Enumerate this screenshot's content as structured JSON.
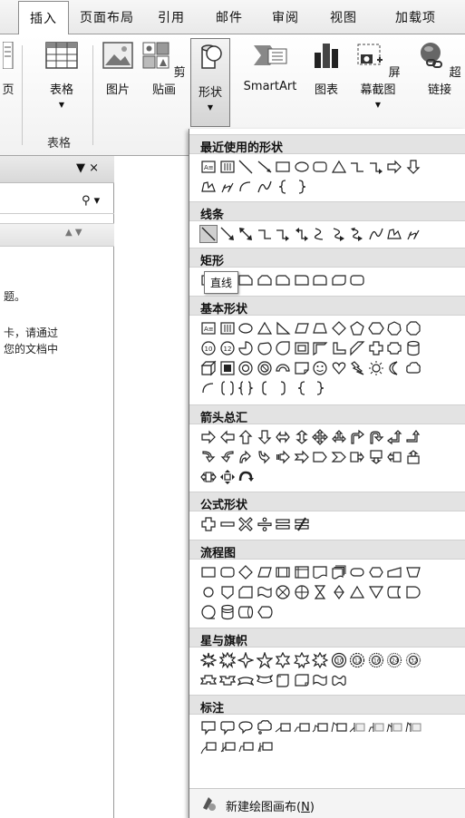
{
  "tabs": [
    {
      "id": "insert",
      "label": "插入",
      "active": true
    },
    {
      "id": "page-layout",
      "label": "页面布局"
    },
    {
      "id": "references",
      "label": "引用"
    },
    {
      "id": "mailings",
      "label": "邮件"
    },
    {
      "id": "review",
      "label": "审阅"
    },
    {
      "id": "view",
      "label": "视图"
    },
    {
      "id": "addins",
      "label": "加载项"
    }
  ],
  "ribbon": {
    "page_label": "页",
    "table_label": "表格",
    "table_group_label": "表格",
    "picture_label": "图片",
    "clipart_label": "剪贴画",
    "shapes_label": "形状",
    "smartart_label": "SmartArt",
    "chart_label": "图表",
    "screenshot_label": "屏幕截图",
    "hyperlink_label": "超链接"
  },
  "doc_pane": {
    "close_glyph": "▼ ×",
    "search_glyph": "⚲ ▾",
    "nav_glyph": "▲ ▼",
    "text_lines": [
      "题。",
      "卡，请通过",
      "您的文档中"
    ]
  },
  "gallery": {
    "sections": {
      "recent": "最近使用的形状",
      "lines": "线条",
      "rectangles": "矩形",
      "basic": "基本形状",
      "arrows": "箭头总汇",
      "equation": "公式形状",
      "flowchart": "流程图",
      "stars": "星与旗帜",
      "callouts": "标注"
    },
    "tooltip": "直线",
    "footer_label": "新建绘图画布",
    "footer_shortcut": "N"
  }
}
